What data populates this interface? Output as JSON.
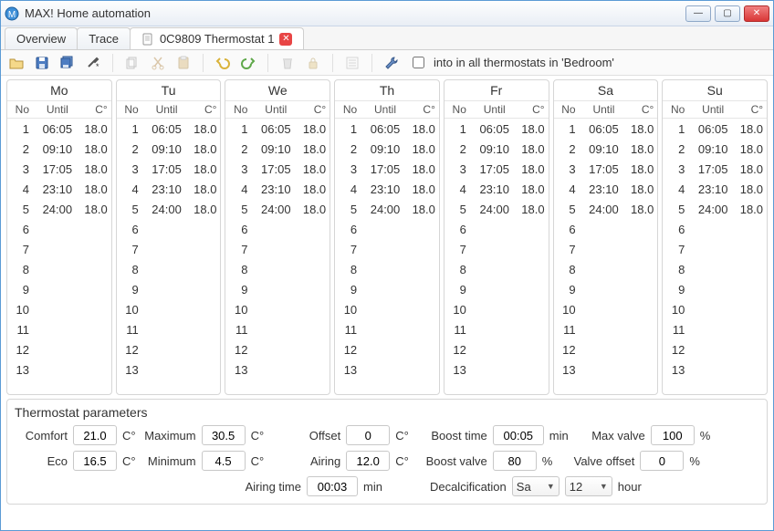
{
  "window": {
    "title": "MAX! Home automation"
  },
  "tabs": {
    "overview": "Overview",
    "trace": "Trace",
    "active": "0C9809 Thermostat 1"
  },
  "toolbar": {
    "copy_label": "into in all thermostats in 'Bedroom'"
  },
  "schedule": {
    "cols": {
      "no": "No",
      "until": "Until",
      "temp": "C°"
    },
    "rows": [
      {
        "no": "1",
        "until": "06:05",
        "temp": "18.0"
      },
      {
        "no": "2",
        "until": "09:10",
        "temp": "18.0"
      },
      {
        "no": "3",
        "until": "17:05",
        "temp": "18.0"
      },
      {
        "no": "4",
        "until": "23:10",
        "temp": "18.0"
      },
      {
        "no": "5",
        "until": "24:00",
        "temp": "18.0"
      },
      {
        "no": "6",
        "until": "",
        "temp": ""
      },
      {
        "no": "7",
        "until": "",
        "temp": ""
      },
      {
        "no": "8",
        "until": "",
        "temp": ""
      },
      {
        "no": "9",
        "until": "",
        "temp": ""
      },
      {
        "no": "10",
        "until": "",
        "temp": ""
      },
      {
        "no": "11",
        "until": "",
        "temp": ""
      },
      {
        "no": "12",
        "until": "",
        "temp": ""
      },
      {
        "no": "13",
        "until": "",
        "temp": ""
      }
    ],
    "days": [
      {
        "label": "Mo"
      },
      {
        "label": "Tu"
      },
      {
        "label": "We"
      },
      {
        "label": "Th"
      },
      {
        "label": "Fr"
      },
      {
        "label": "Sa"
      },
      {
        "label": "Su"
      }
    ]
  },
  "params": {
    "title": "Thermostat parameters",
    "labels": {
      "comfort": "Comfort",
      "degC": "C°",
      "maximum": "Maximum",
      "eco": "Eco",
      "minimum": "Minimum",
      "offset": "Offset",
      "boost_time": "Boost time",
      "min": "min",
      "max_valve": "Max valve",
      "pct": "%",
      "airing": "Airing",
      "boost_valve": "Boost valve",
      "valve_offset": "Valve offset",
      "airing_time": "Airing time",
      "decalc": "Decalcification",
      "hour": "hour"
    },
    "values": {
      "comfort": "21.0",
      "maximum": "30.5",
      "eco": "16.5",
      "minimum": "4.5",
      "offset": "0",
      "boost_time": "00:05",
      "max_valve": "100",
      "airing": "12.0",
      "boost_valve": "80",
      "valve_offset": "0",
      "airing_time": "00:03",
      "decalc_day": "Sa",
      "decalc_hour": "12"
    }
  }
}
